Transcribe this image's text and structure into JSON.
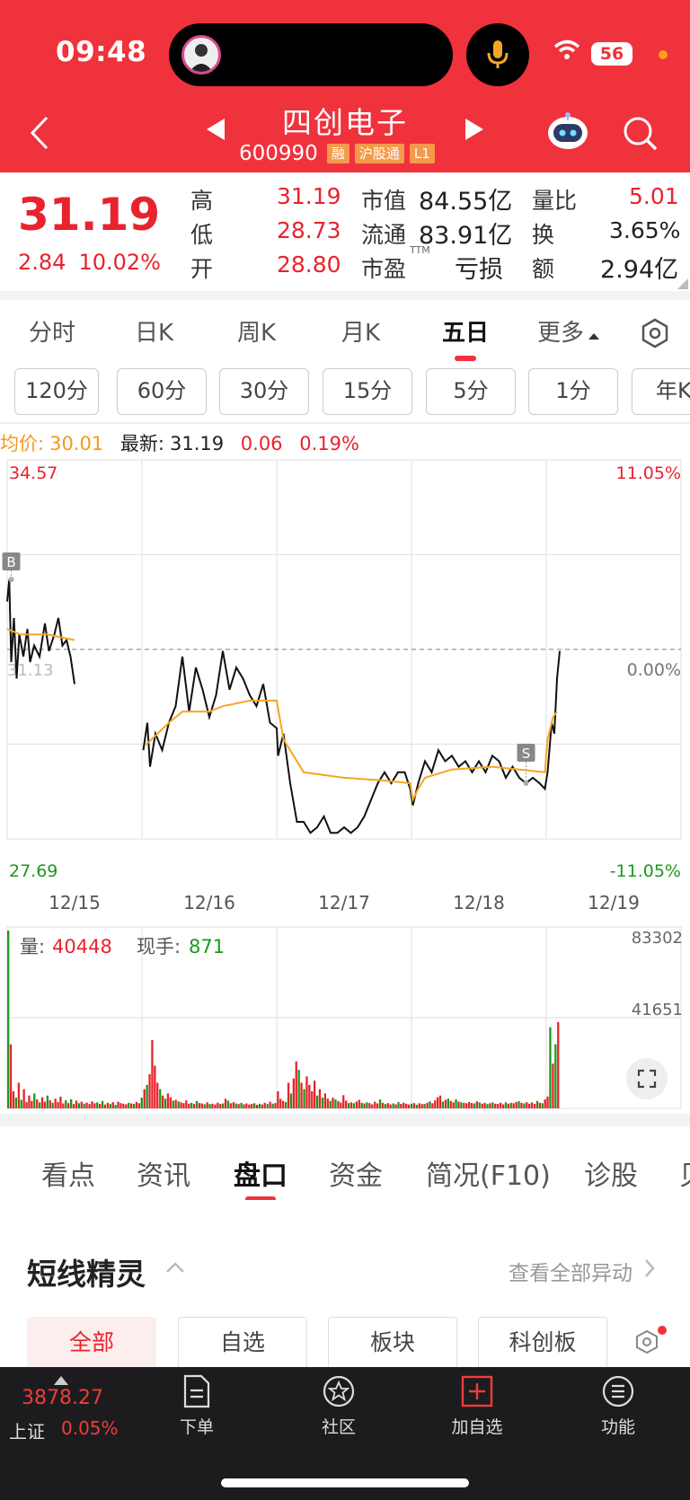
{
  "status_bar": {
    "time": "09:48",
    "battery": "56"
  },
  "header": {
    "stock_name": "四创电子",
    "stock_code": "600990",
    "tags": [
      "融",
      "沪股通",
      "L1"
    ]
  },
  "quote": {
    "price": "31.19",
    "change": "2.84",
    "change_pct": "10.02%",
    "high_label": "高",
    "high": "31.19",
    "low_label": "低",
    "low": "28.73",
    "open_label": "开",
    "open": "28.80",
    "mcap_label": "市值",
    "mcap": "84.55亿",
    "float_label": "流通",
    "float": "83.91亿",
    "pe_label": "市盈",
    "pe_sup": "TTM",
    "pe": "亏损",
    "vr_label": "量比",
    "vr": "5.01",
    "turnover_label": "换",
    "turnover": "3.65%",
    "amount_label": "额",
    "amount": "2.94亿"
  },
  "period_tabs": [
    "分时",
    "日K",
    "周K",
    "月K",
    "五日",
    "更多"
  ],
  "minute_tabs": [
    "120分",
    "60分",
    "30分",
    "15分",
    "5分",
    "1分",
    "年K"
  ],
  "info_line": {
    "avg_label": "均价:",
    "avg": "30.01",
    "latest_label": "最新:",
    "latest": "31.19",
    "delta": "0.06",
    "delta_pct": "0.19%"
  },
  "chart_data": {
    "type": "line",
    "title": "五日",
    "x": [
      "12/15",
      "12/16",
      "12/17",
      "12/18",
      "12/19"
    ],
    "y_max": "34.57",
    "y_min": "27.69",
    "pct_max": "11.05%",
    "pct_min": "-11.05%",
    "pct_mid": "0.00%",
    "prev_close_label": "31.13",
    "ylim": [
      27.69,
      34.57
    ],
    "markers": [
      "B",
      "S"
    ],
    "series": [
      {
        "name": "price",
        "color": "#111111",
        "values": [
          [
            0,
            32.0
          ],
          [
            0.015,
            32.4
          ],
          [
            0.03,
            30.9
          ],
          [
            0.05,
            31.7
          ],
          [
            0.07,
            30.6
          ],
          [
            0.09,
            31.4
          ],
          [
            0.12,
            31.0
          ],
          [
            0.15,
            31.5
          ],
          [
            0.17,
            30.9
          ],
          [
            0.2,
            31.2
          ],
          [
            0.24,
            31.0
          ],
          [
            0.28,
            31.6
          ],
          [
            0.31,
            31.1
          ],
          [
            0.35,
            31.4
          ],
          [
            0.38,
            31.7
          ],
          [
            0.41,
            31.2
          ],
          [
            0.44,
            31.3
          ],
          [
            0.47,
            31.0
          ],
          [
            0.5,
            30.5
          ],
          [
            1.01,
            29.3
          ],
          [
            1.04,
            29.8
          ],
          [
            1.06,
            29.0
          ],
          [
            1.1,
            29.6
          ],
          [
            1.15,
            29.3
          ],
          [
            1.2,
            29.8
          ],
          [
            1.25,
            30.1
          ],
          [
            1.3,
            31.0
          ],
          [
            1.35,
            30.0
          ],
          [
            1.4,
            30.8
          ],
          [
            1.45,
            30.4
          ],
          [
            1.5,
            29.9
          ],
          [
            1.55,
            30.3
          ],
          [
            1.6,
            31.1
          ],
          [
            1.65,
            30.4
          ],
          [
            1.7,
            30.8
          ],
          [
            1.75,
            30.6
          ],
          [
            1.8,
            30.3
          ],
          [
            1.85,
            30.1
          ],
          [
            1.9,
            30.5
          ],
          [
            1.95,
            29.8
          ],
          [
            2.0,
            29.7
          ],
          [
            2.01,
            29.2
          ],
          [
            2.05,
            29.6
          ],
          [
            2.1,
            28.7
          ],
          [
            2.15,
            28.0
          ],
          [
            2.2,
            28.0
          ],
          [
            2.25,
            27.8
          ],
          [
            2.3,
            27.9
          ],
          [
            2.35,
            28.1
          ],
          [
            2.4,
            27.8
          ],
          [
            2.45,
            27.8
          ],
          [
            2.5,
            27.9
          ],
          [
            2.55,
            27.8
          ],
          [
            2.6,
            27.9
          ],
          [
            2.65,
            28.1
          ],
          [
            2.7,
            28.4
          ],
          [
            2.75,
            28.7
          ],
          [
            2.8,
            28.9
          ],
          [
            2.85,
            28.7
          ],
          [
            2.9,
            28.9
          ],
          [
            2.95,
            28.9
          ],
          [
            2.99,
            28.6
          ],
          [
            3.01,
            28.3
          ],
          [
            3.05,
            28.7
          ],
          [
            3.1,
            29.1
          ],
          [
            3.15,
            28.9
          ],
          [
            3.2,
            29.3
          ],
          [
            3.25,
            29.1
          ],
          [
            3.3,
            29.2
          ],
          [
            3.35,
            29.0
          ],
          [
            3.4,
            29.1
          ],
          [
            3.45,
            28.9
          ],
          [
            3.5,
            29.1
          ],
          [
            3.55,
            28.9
          ],
          [
            3.6,
            29.2
          ],
          [
            3.65,
            29.1
          ],
          [
            3.7,
            28.8
          ],
          [
            3.75,
            29.0
          ],
          [
            3.8,
            28.8
          ],
          [
            3.85,
            28.7
          ],
          [
            3.9,
            28.8
          ],
          [
            3.95,
            28.7
          ],
          [
            3.99,
            28.6
          ],
          [
            4.01,
            28.9
          ],
          [
            4.04,
            29.8
          ],
          [
            4.06,
            29.6
          ],
          [
            4.08,
            30.6
          ],
          [
            4.1,
            31.1
          ]
        ]
      },
      {
        "name": "avg",
        "color": "#f5a623",
        "values": [
          [
            0,
            31.5
          ],
          [
            0.1,
            31.4
          ],
          [
            0.3,
            31.4
          ],
          [
            0.5,
            31.3
          ],
          [
            1.03,
            29.4
          ],
          [
            1.2,
            29.8
          ],
          [
            1.3,
            30.0
          ],
          [
            1.5,
            30.0
          ],
          [
            1.6,
            30.1
          ],
          [
            1.8,
            30.2
          ],
          [
            2.0,
            30.2
          ],
          [
            2.05,
            29.5
          ],
          [
            2.2,
            28.9
          ],
          [
            2.5,
            28.8
          ],
          [
            2.8,
            28.75
          ],
          [
            2.99,
            28.7
          ],
          [
            3.01,
            28.4
          ],
          [
            3.05,
            28.6
          ],
          [
            3.1,
            28.8
          ],
          [
            3.3,
            28.95
          ],
          [
            3.6,
            29.0
          ],
          [
            3.99,
            28.9
          ],
          [
            4.01,
            29.5
          ],
          [
            4.05,
            29.9
          ],
          [
            4.08,
            30.0
          ]
        ]
      }
    ]
  },
  "volume": {
    "label": "量:",
    "value": "40448",
    "hand_label": "现手:",
    "hand": "871",
    "max": "83302",
    "mid": "41651",
    "bars": [
      83302,
      30000,
      8000,
      5000,
      12000,
      4000,
      9000,
      3000,
      6000,
      3500,
      7000,
      4200,
      2800,
      5200,
      3100,
      6000,
      3800,
      2600,
      4500,
      3000,
      5500,
      2300,
      3800,
      2500,
      4300,
      2000,
      3600,
      2400,
      3100,
      2200,
      2700,
      2000,
      3300,
      2400,
      2800,
      2100,
      3500,
      1800,
      2600,
      2000,
      2900,
      1700,
      3100,
      2500,
      2200,
      1900,
      2600,
      2300,
      2100,
      3000,
      2400,
      5000,
      9000,
      11000,
      16000,
      32000,
      20000,
      12000,
      9000,
      6000,
      4500,
      7000,
      5200,
      3600,
      4000,
      3300,
      2800,
      2500,
      3700,
      2200,
      2600,
      2000,
      3400,
      2500,
      2300,
      1900,
      2800,
      2000,
      2200,
      1800,
      2700,
      2100,
      2300,
      4500,
      3600,
      2400,
      2900,
      2300,
      2000,
      2600,
      1900,
      2300,
      1800,
      2100,
      2400,
      1700,
      2200,
      1800,
      2600,
      2000,
      3100,
      2200,
      2500,
      8000,
      4500,
      3500,
      3000,
      12000,
      7000,
      14000,
      22000,
      18000,
      12000,
      9000,
      15000,
      11000,
      8000,
      13000,
      6000,
      9000,
      5000,
      7000,
      4600,
      3500,
      5000,
      4200,
      3400,
      2700,
      6200,
      3600,
      2500,
      2800,
      2400,
      3200,
      4000,
      2600,
      2300,
      2800,
      2500,
      1900,
      3100,
      2300,
      4200,
      2600,
      2000,
      2500,
      1800,
      2300,
      1900,
      3000,
      2100,
      2700,
      2200,
      1800,
      2200,
      2500,
      1700,
      2400,
      2000,
      2100,
      2600,
      3300,
      2400,
      3800,
      5200,
      6000,
      3200,
      4000,
      4600,
      3500,
      2800,
      4200,
      3200,
      2800,
      2600,
      2400,
      3000,
      2500,
      2300,
      3300,
      2800,
      2200,
      2600,
      2000,
      2400,
      2800,
      2200,
      2100,
      2600,
      1900,
      2800,
      2200,
      2600,
      2400,
      3000,
      3400,
      2600,
      2300,
      2900,
      2200,
      2800,
      2100,
      3500,
      2600,
      2400,
      4200,
      5500,
      38000,
      21000,
      30000,
      40448
    ],
    "bar_colors_pattern": "mixed"
  },
  "content_tabs": [
    "看点",
    "资讯",
    "盘口",
    "资金",
    "简况(F10)",
    "诊股",
    "贝"
  ],
  "section": {
    "title": "短线精灵",
    "see_all": "查看全部异动"
  },
  "filter_tabs": [
    "全部",
    "自选",
    "板块",
    "科创板"
  ],
  "bottom_nav": {
    "index_value": "3878.27",
    "index_name": "上证",
    "index_pct": "0.05%",
    "items": [
      {
        "label": "下单",
        "icon": "order-icon"
      },
      {
        "label": "社区",
        "icon": "community-icon"
      },
      {
        "label": "加自选",
        "icon": "add-watchlist-icon"
      },
      {
        "label": "功能",
        "icon": "menu-icon"
      }
    ]
  },
  "colors": {
    "brand_red": "#f0323c",
    "up": "#e8232d",
    "down": "#1a9a1a",
    "avg": "#f5a623"
  }
}
